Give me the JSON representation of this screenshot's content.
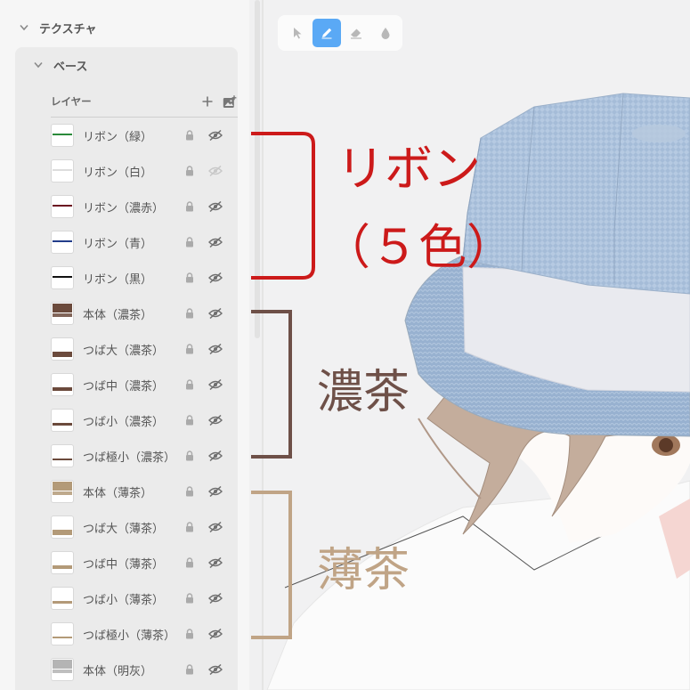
{
  "panel": {
    "section_title": "テクスチャ",
    "base_title": "ベース",
    "layers_title": "レイヤー",
    "layers": [
      {
        "name": "リボン（緑）",
        "kind": "line",
        "color": "#2a8a3a",
        "visible": true
      },
      {
        "name": "リボン（白）",
        "kind": "line",
        "color": "#dddddd",
        "visible": false
      },
      {
        "name": "リボン（濃赤）",
        "kind": "line",
        "color": "#6b1020",
        "visible": true
      },
      {
        "name": "リボン（青）",
        "kind": "line",
        "color": "#223d8a",
        "visible": true
      },
      {
        "name": "リボン（黒）",
        "kind": "line",
        "color": "#111111",
        "visible": true
      },
      {
        "name": "本体（濃茶）",
        "kind": "body",
        "color": "#6b4a3c",
        "visible": true
      },
      {
        "name": "つば大（濃茶）",
        "kind": "brim-large",
        "color": "#6b4a3c",
        "visible": true
      },
      {
        "name": "つば中（濃茶）",
        "kind": "brim-mid",
        "color": "#6b4a3c",
        "visible": true
      },
      {
        "name": "つば小（濃茶）",
        "kind": "brim-small",
        "color": "#6b4a3c",
        "visible": true
      },
      {
        "name": "つば極小（濃茶）",
        "kind": "brim-tiny",
        "color": "#6b4a3c",
        "visible": true
      },
      {
        "name": "本体（薄茶）",
        "kind": "body",
        "color": "#b39a78",
        "visible": true
      },
      {
        "name": "つば大（薄茶）",
        "kind": "brim-large",
        "color": "#b39a78",
        "visible": true
      },
      {
        "name": "つば中（薄茶）",
        "kind": "brim-mid",
        "color": "#b39a78",
        "visible": true
      },
      {
        "name": "つば小（薄茶）",
        "kind": "brim-small",
        "color": "#b39a78",
        "visible": true
      },
      {
        "name": "つば極小（薄茶）",
        "kind": "brim-tiny",
        "color": "#b39a78",
        "visible": true
      },
      {
        "name": "本体（明灰）",
        "kind": "body",
        "color": "#b4b4b4",
        "visible": true
      }
    ]
  },
  "toolbar": {
    "tools": [
      {
        "icon": "cursor-icon",
        "active": false
      },
      {
        "icon": "pencil-icon",
        "active": true
      },
      {
        "icon": "eraser-icon",
        "active": false
      },
      {
        "icon": "fill-drop-icon",
        "active": false
      }
    ],
    "accent": "#5aa9f5"
  },
  "annotations": {
    "ribbon_line1": "リボン",
    "ribbon_line2": "（５色）",
    "dark_brown": "濃茶",
    "light_brown": "薄茶",
    "ribbon_color": "#cc1a1a",
    "dark_brown_color": "#6e5048",
    "light_brown_color": "#c0a486"
  }
}
